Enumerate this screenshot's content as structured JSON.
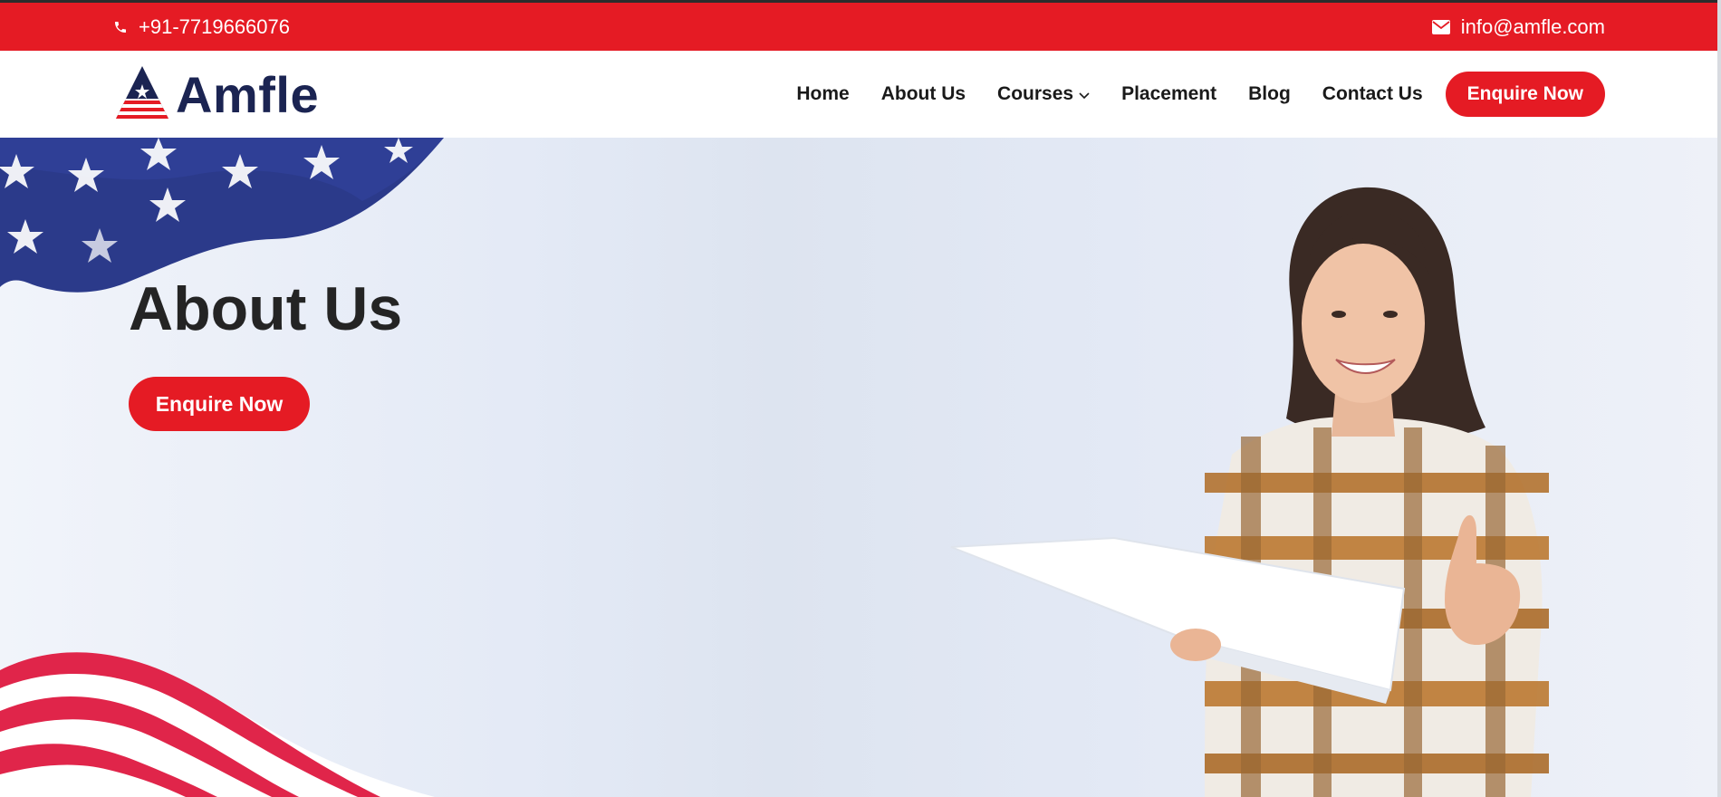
{
  "topbar": {
    "phone_icon": "phone-icon",
    "phone": "+91-7719666076",
    "email_icon": "envelope-icon",
    "email": "info@amfle.com",
    "bg_color": "#e51b24"
  },
  "header": {
    "logo_text": "Amfle",
    "nav": [
      {
        "label": "Home"
      },
      {
        "label": "About Us"
      },
      {
        "label": "Courses"
      },
      {
        "label": "Placement"
      },
      {
        "label": "Blog"
      },
      {
        "label": "Contact Us"
      }
    ],
    "cta_label": "Enquire Now",
    "brand_navy": "#1b2452"
  },
  "hero": {
    "title": "About Us",
    "cta_label": "Enquire Now",
    "decor_icons": [
      "flag-stars-icon",
      "flag-stripes-icon"
    ]
  }
}
